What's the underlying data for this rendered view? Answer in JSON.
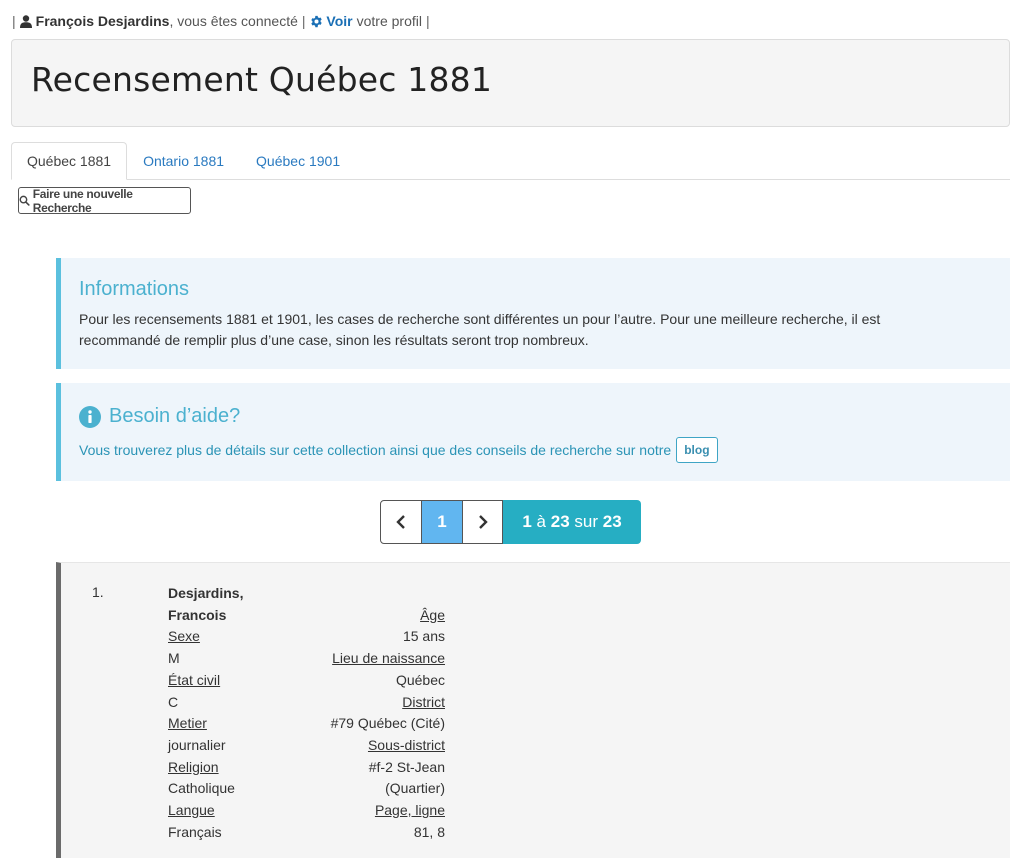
{
  "topbar": {
    "sep": "|",
    "user_name": "François Desjardins",
    "connected_text": ", vous êtes connecté",
    "view_link": "Voir",
    "profile_text": "votre profil"
  },
  "header": {
    "title": "Recensement Québec 1881"
  },
  "tabs": [
    {
      "label": "Québec 1881",
      "active": true
    },
    {
      "label": "Ontario 1881",
      "active": false
    },
    {
      "label": "Québec 1901",
      "active": false
    }
  ],
  "new_search": {
    "label": "Faire une nouvelle Recherche"
  },
  "info_box": {
    "title": "Informations",
    "text": "Pour les recensements 1881 et 1901, les cases de recherche sont différentes un pour l’autre. Pour une meilleure recherche, il est recommandé de remplir plus d’une case, sinon les résultats seront trop nombreux."
  },
  "help_box": {
    "title": "Besoin d’aide?",
    "text": "Vous trouverez plus de détails sur cette collection ainsi que des conseils de recherche sur notre",
    "blog_label": "blog"
  },
  "pagination": {
    "current_page": "1",
    "range_start": "1",
    "range_word": "à",
    "range_end": "23",
    "total_word": "sur",
    "total": "23"
  },
  "record": {
    "number": "1.",
    "name_line1": "Desjardins,",
    "name_line2": "Francois",
    "sex_label": "Sexe",
    "sex_value": "M",
    "civil_label": "État civil",
    "civil_value": "C",
    "job_label": "Metier",
    "job_value": "journalier",
    "religion_label": "Religion",
    "religion_value": "Catholique",
    "language_label": "Langue",
    "language_value": "Français",
    "age_label": "Âge",
    "age_value": "15 ans",
    "birthplace_label": "Lieu de naissance",
    "birthplace_value": "Québec",
    "district_label": "District",
    "district_value": "#79 Québec (Cité)",
    "subdistrict_label": "Sous-district",
    "subdistrict_value1": "#f-2 St-Jean",
    "subdistrict_value2": "(Quartier)",
    "page_label": "Page, ligne",
    "page_value": "81, 8"
  }
}
